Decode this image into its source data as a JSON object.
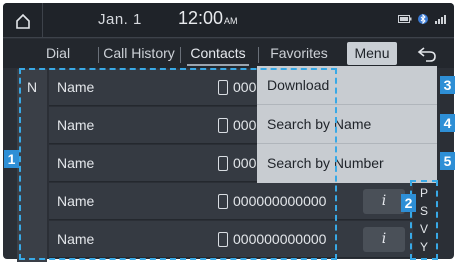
{
  "status": {
    "date": "Jan.  1",
    "time": "12:00",
    "ampm": "AM"
  },
  "tabs": [
    {
      "label": "Dial"
    },
    {
      "label": "Call History"
    },
    {
      "label": "Contacts",
      "active": true
    },
    {
      "label": "Favorites"
    }
  ],
  "menu_label": "Menu",
  "index_letter": "N",
  "contacts": [
    {
      "name": "Name",
      "number": "000"
    },
    {
      "name": "Name",
      "number": "000"
    },
    {
      "name": "Name",
      "number": "000"
    },
    {
      "name": "Name",
      "number": "000000000000"
    },
    {
      "name": "Name",
      "number": "000000000000"
    }
  ],
  "info_glyph": "i",
  "scroll_letters": [
    "P",
    "S",
    "V",
    "Y"
  ],
  "menu_items": [
    {
      "label": "Download"
    },
    {
      "label": "Search by Name"
    },
    {
      "label": "Search by Number"
    }
  ],
  "callouts": [
    "1",
    "2",
    "3",
    "4",
    "5"
  ],
  "colors": {
    "accent": "#2e8fd6",
    "dash": "#38a9e6"
  }
}
